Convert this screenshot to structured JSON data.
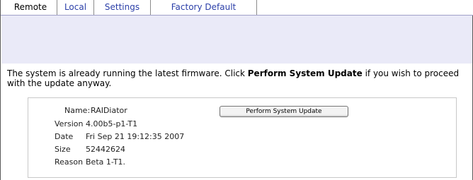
{
  "tabs": [
    {
      "label": "Remote",
      "active": true
    },
    {
      "label": "Local",
      "active": false
    },
    {
      "label": "Settings",
      "active": false
    },
    {
      "label": "Factory Default",
      "active": false
    }
  ],
  "message": {
    "prefix": "The system is already running the latest firmware. Click ",
    "emphasis": "Perform System Update",
    "suffix": " if you wish to proceed with the update anyway."
  },
  "firmware": {
    "name_label": "Name:",
    "name_value": "RAIDiator",
    "version_label": "Version",
    "version_value": "4.00b5-p1-T1",
    "date_label": "Date",
    "date_value": "Fri Sep 21 19:12:35 2007",
    "size_label": "Size",
    "size_value": "52442624",
    "reason_label": "Reason",
    "reason_value": "Beta 1-T1."
  },
  "update_button": {
    "label": "Perform System Update"
  },
  "colors": {
    "header_band": "#eaeaf8",
    "tab_link": "#2a3ea8",
    "panel_border": "#c8c8c8"
  }
}
